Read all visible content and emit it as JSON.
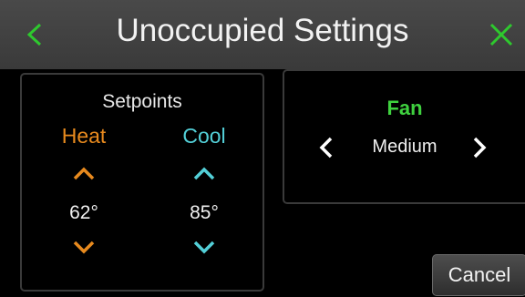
{
  "header": {
    "title": "Unoccupied Settings",
    "back_icon": "chevron-left-icon",
    "close_icon": "close-icon",
    "accent": "#2ec92e"
  },
  "setpoints": {
    "title": "Setpoints",
    "heat": {
      "label": "Heat",
      "value": "62°",
      "color": "#e88a1e"
    },
    "cool": {
      "label": "Cool",
      "value": "85°",
      "color": "#53d0d8"
    }
  },
  "fan": {
    "label": "Fan",
    "value": "Medium",
    "color": "#3fd13f"
  },
  "footer": {
    "cancel_label": "Cancel"
  }
}
